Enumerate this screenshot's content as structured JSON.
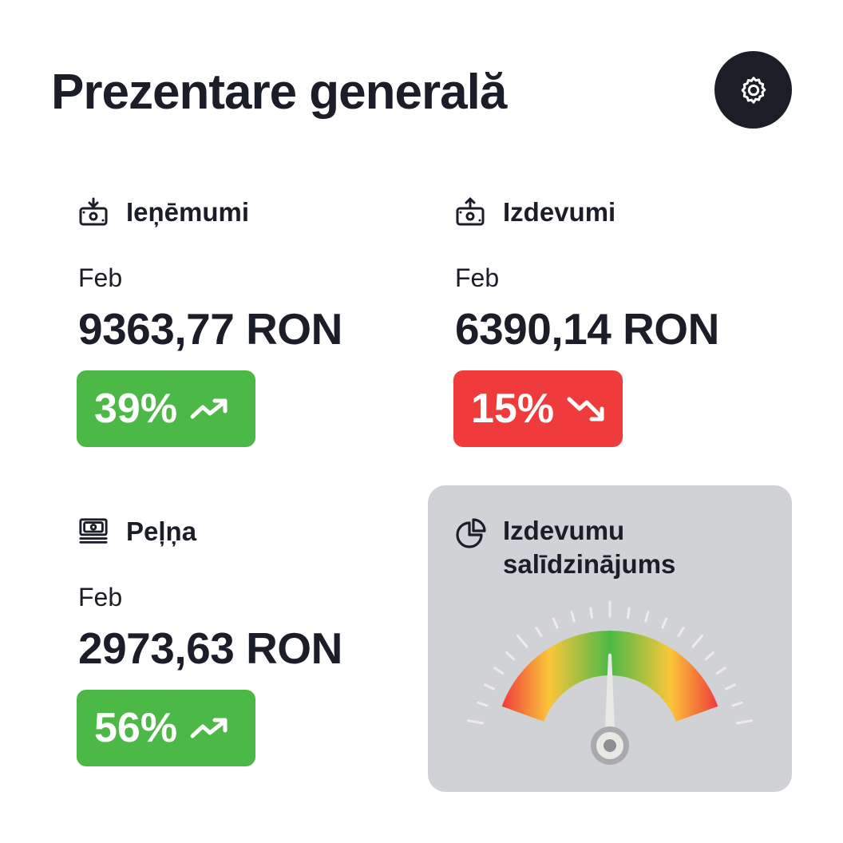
{
  "header": {
    "title": "Prezentare generală",
    "settings_icon": "gear-icon"
  },
  "cards": {
    "income": {
      "title": "Ieņēmumi",
      "icon": "money-in-icon",
      "period": "Feb",
      "amount": "9363,77 RON",
      "change": "39%",
      "trend": "up",
      "trend_icon": "trending-up-icon",
      "color": "#4cb947"
    },
    "expenses": {
      "title": "Izdevumi",
      "icon": "money-out-icon",
      "period": "Feb",
      "amount": "6390,14 RON",
      "change": "15%",
      "trend": "down",
      "trend_icon": "trending-down-icon",
      "color": "#ef3b3b"
    },
    "profit": {
      "title": "Peļņa",
      "icon": "cash-stack-icon",
      "period": "Feb",
      "amount": "2973,63 RON",
      "change": "56%",
      "trend": "up",
      "trend_icon": "trending-up-icon",
      "color": "#4cb947"
    },
    "comparison": {
      "title": "Izdevumu salīdzinājums",
      "icon": "pie-chart-icon",
      "gauge_value": 0.5,
      "gauge_colors": [
        "#ef3b3b",
        "#fbc63a",
        "#4cb947"
      ]
    }
  }
}
